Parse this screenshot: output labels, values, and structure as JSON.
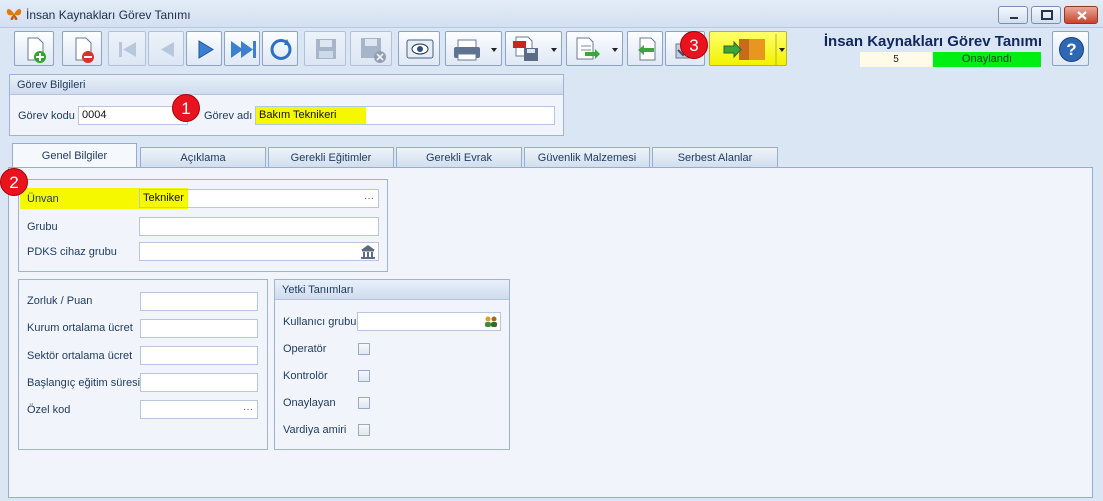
{
  "window": {
    "title": "İnsan Kaynakları Görev Tanımı"
  },
  "toolbar": {
    "buttons": [
      {
        "icon": "new-record-icon"
      },
      {
        "icon": "delete-record-icon"
      },
      {
        "icon": "first-record-icon"
      },
      {
        "icon": "previous-record-icon"
      },
      {
        "icon": "next-record-icon"
      },
      {
        "icon": "last-record-icon"
      },
      {
        "icon": "refresh-icon"
      },
      {
        "icon": "save-icon"
      },
      {
        "icon": "cancel-save-icon"
      },
      {
        "icon": "preview-icon"
      },
      {
        "icon": "print-icon"
      },
      {
        "icon": "pdf-export-icon"
      },
      {
        "icon": "export-icon"
      },
      {
        "icon": "import-icon"
      },
      {
        "icon": "approve-icon"
      },
      {
        "icon": "workflow-icon"
      },
      {
        "icon": "help-icon"
      }
    ]
  },
  "header": {
    "title": "İnsan Kaynakları Görev Tanımı",
    "count": "5",
    "status": "Onaylandı",
    "status_color": "#00ee11"
  },
  "gorev_bilgileri": {
    "caption": "Görev Bilgileri",
    "code_label": "Görev kodu",
    "code_value": "0004",
    "name_label": "Görev adı",
    "name_value": "Bakım Teknikeri"
  },
  "tabs": [
    "Genel Bilgiler",
    "Açıklama",
    "Gerekli Eğitimler",
    "Gerekli Evrak",
    "Güvenlik Malzemesi",
    "Serbest Alanlar"
  ],
  "genel": {
    "unvan_label": "Ünvan",
    "unvan_value": "Tekniker",
    "grubu_label": "Grubu",
    "grubu_value": "",
    "pdks_label": "PDKS cihaz grubu",
    "pdks_value": ""
  },
  "puan": {
    "zorluk_label": "Zorluk / Puan",
    "kurum_label": "Kurum ortalama ücret",
    "sektor_label": "Sektör ortalama ücret",
    "baslangic_label": "Başlangıç eğitim süresi",
    "ozel_label": "Özel kod"
  },
  "yetki": {
    "caption": "Yetki Tanımları",
    "kullanici_label": "Kullanıcı grubu",
    "checks": [
      {
        "label": "Operatör",
        "checked": false
      },
      {
        "label": "Kontrolör",
        "checked": false
      },
      {
        "label": "Onaylayan",
        "checked": false
      },
      {
        "label": "Vardiya amiri",
        "checked": false
      }
    ]
  },
  "badges": [
    "1",
    "2",
    "3"
  ],
  "ellipsis": "···"
}
